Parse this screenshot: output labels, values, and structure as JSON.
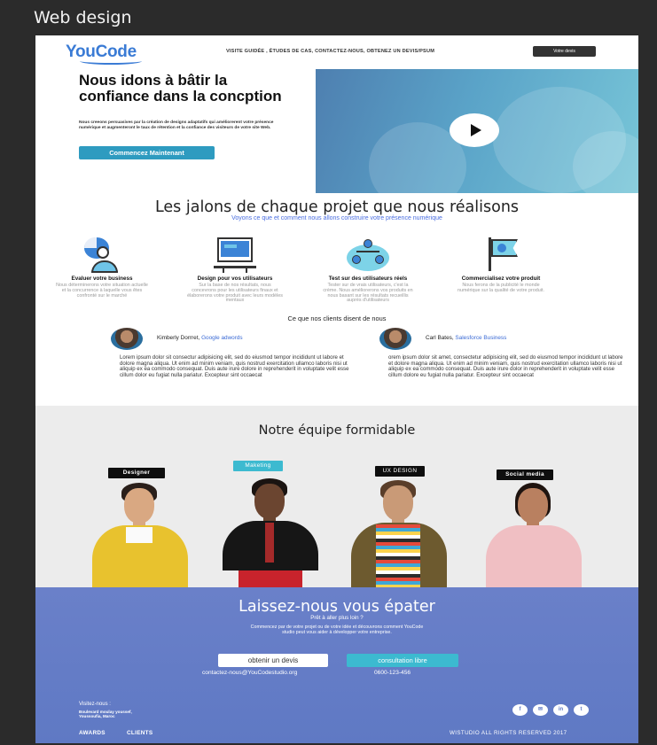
{
  "window": {
    "title": "Web design"
  },
  "nav": {
    "logo": "YouCode",
    "links": "VISITE GUIDÉE , ÉTUDES DE CAS, CONTACTEZ-NOUS, OBTENEZ UN DEVIS/PSUM",
    "button": "Votre devis"
  },
  "hero": {
    "title": "Nous idons à bâtir la confiance dans la concption",
    "text": "Nous creeons persuasives par la création de designs adaptatifs qui améliorerent votre présence numérique et augmenteront le taux de rétention et la confiance des visiteurs de votre site Web.",
    "button": "Commencez Maintenant"
  },
  "milestones": {
    "title": "Les jalons de chaque projet que nous réalisons",
    "subtitle": "Voyons ce que et comment nous allons construire votre présence numérique",
    "features": [
      {
        "title": "Evaluer votre business",
        "desc": "Nous déterminerons votre situation actuelle et la concurrence à laquelle vous êtes confronté sur le marché",
        "icon": "analytics-person-icon"
      },
      {
        "title": "Design pour vos utilisateurs",
        "desc": "Sur la base de nos résultats, nous concevrons pour les utilisateurs finaux et élaborerons votre produit avec leurs modèles mentaux",
        "icon": "design-monitor-icon"
      },
      {
        "title": "Test sur des utilisateurs réels",
        "desc": "Tester sur de vrais utilisateurs, c'est la crème. Nous améliorerons vos produits en nous basant sur les résultats recueillis auprès d'utilisateurs",
        "icon": "user-network-icon"
      },
      {
        "title": "Commercialisez votre produit",
        "desc": "Nous ferons de la publicité le monde numérique sur la qualité de votre produit.",
        "icon": "flag-check-icon"
      }
    ]
  },
  "clients": {
    "title": "Ce que nos clients disent de nous",
    "testimonials": [
      {
        "name": "Kimberly Dorrret,",
        "company": "Google adwords",
        "text": "Lorem ipsum dolor sit consectur adipisicing elit, sed do eiusmod tempor incididunt ut labore et dolore magna aliqua. Ut enim ad minim veniam, quis nostrud exercitation ullamco laboris nisi ut aliquip ex ea commodo consequat. Duis aute irure dolore in reprehenderit in voluptate velit esse cillum dolor eu fugiat nulla pariatur. Excepteur sint occaecat"
      },
      {
        "name": "Carl Bates,",
        "company": "Salesforce Business",
        "text": "orem ipsum dolor sit amet, consectetur adipisicing elit, sed do eiusmod tempor incididunt ut labore et dolore magna aliqua. Ut enim ad minim veniam, quis nostrud exercitation ullamco laboris nisi ut aliquip ex ea commodo consequat. Duis aute irure dolor in reprehenderit in voluptate velit esse cillum dolore eu fugiat nulla pariatur. Excepteur sint occaecat"
      }
    ]
  },
  "team": {
    "title": "Notre équipe formidable",
    "roles": [
      "Designer",
      "Maketing",
      "UX DESIGN",
      "Social media"
    ]
  },
  "footer": {
    "title": "Laissez-nous vous épater",
    "subtitle": "Prêt à aller plus loin ?",
    "text": "Commencez par de votre projet ou de votre idée et découvrons comment YouCode studio peut vous aider à développer votre entreprise.",
    "quote_button": "obtenir un devis",
    "consult_button": "consultation libre",
    "email": "contactez-nous@YouCodestudio.org",
    "phone": "0600-123-456",
    "visit_label": "Visitez-nous :",
    "address": "Boulevard moulay youssef, Youssoufia, Maroc",
    "socials": [
      "f",
      "✉",
      "in",
      "t"
    ],
    "links": [
      "AWARDS",
      "CLIENTS"
    ],
    "copyright": "WISTUDIO ALL RIGHTS RESERVED 2017"
  }
}
